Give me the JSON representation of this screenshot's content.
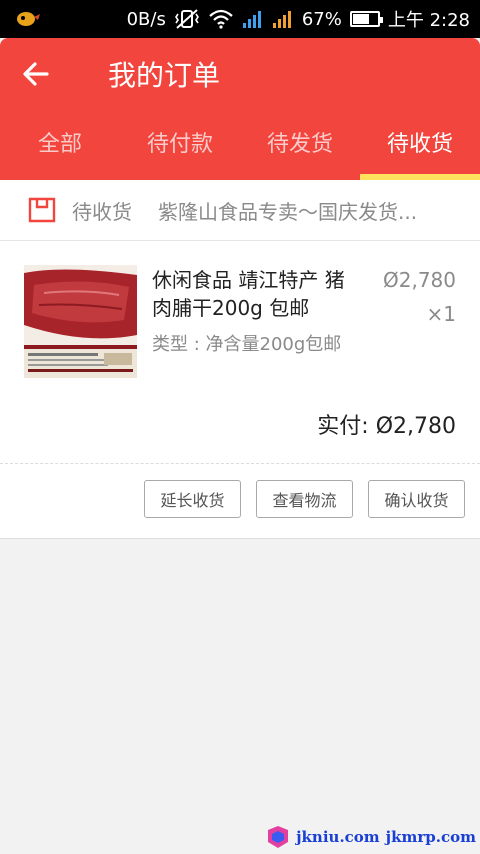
{
  "status_bar": {
    "network_speed": "0B/s",
    "battery_percent": "67%",
    "battery_level": 0.67,
    "time": "上午 2:28"
  },
  "header": {
    "title": "我的订单",
    "tabs": [
      {
        "label": "全部"
      },
      {
        "label": "待付款"
      },
      {
        "label": "待发货"
      },
      {
        "label": "待收货"
      }
    ],
    "active_tab": "待收货",
    "colors": {
      "header_bg": "#f2453d",
      "indicator": "#ffe35c"
    }
  },
  "order": {
    "status": "待收货",
    "shop_name": "紫隆山食品专卖～国庆发货...",
    "item": {
      "title": "休闲食品 靖江特产 猪肉脯干200g 包邮",
      "spec": "类型 : 净含量200g包邮",
      "price": "2,780",
      "quantity": "×1"
    },
    "paid_label": "实付:",
    "paid_amount": "2,780",
    "actions": [
      {
        "label": "延长收货"
      },
      {
        "label": "查看物流"
      },
      {
        "label": "确认收货"
      }
    ]
  },
  "watermark": {
    "text1": "jkniu.com",
    "text2": "jkmrp.com"
  }
}
